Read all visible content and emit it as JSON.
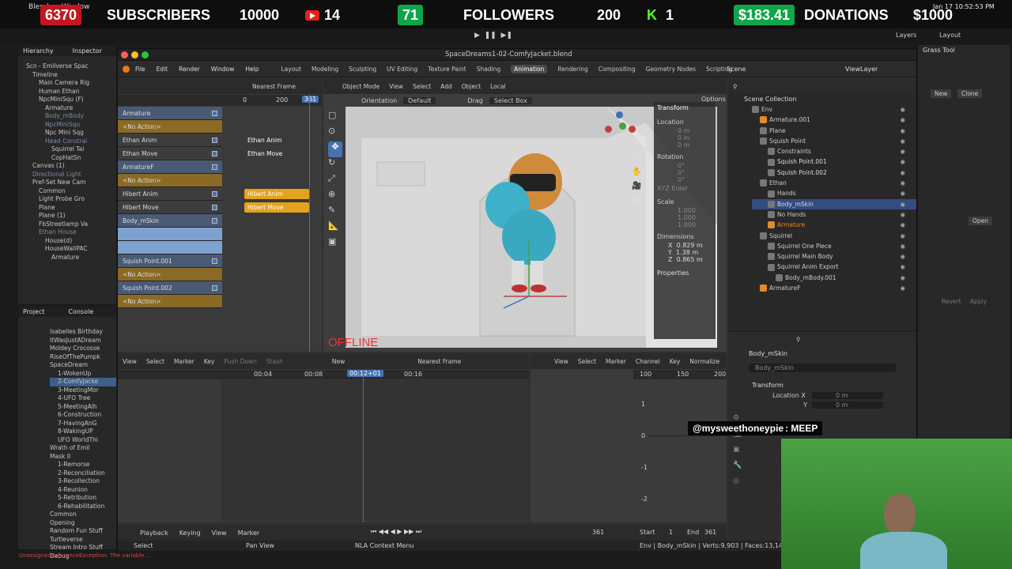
{
  "stream_bar": {
    "app_label": "Blender",
    "window_label": "Window",
    "subscriber_count": "6370",
    "subscribers_label": "SUBSCRIBERS",
    "subscriber_goal": "10000",
    "youtube_count": "14",
    "follower_count": "71",
    "followers_label": "FOLLOWERS",
    "follower_goal": "200",
    "kick_count": "1",
    "donation_amount": "$183.41",
    "donations_label": "DONATIONS",
    "donation_goal": "$1000",
    "clock": "Jan 17 10:52:53 PM"
  },
  "unity": {
    "hierarchy_tab": "Hierarchy",
    "inspector_tab": "Inspector",
    "project_tab": "Project",
    "console_tab": "Console",
    "toolbar": {
      "layers": "Layers",
      "layout": "Layout"
    },
    "hierarchy_items": [
      "Scn - Emilverse Spac",
      "Timeline",
      "Main Camera Rig",
      "Human Ethan",
      "NpcMiniSqu (F)",
      "Armature",
      "Body_mBody",
      "NpcMiniSqu",
      "Npc Mini Sqg",
      "Head Constrai",
      "Squirrel Tai",
      "CopHatSn",
      "Canvas (1)",
      "Directional Light",
      "Pref-Set New Cam",
      "Common",
      "Light Probe Gro",
      "Plane",
      "Plane (1)",
      "FbStreetlamp Va",
      "Ethan House",
      "House(d)",
      "HouseWallPAC",
      "Armature"
    ],
    "project_items": [
      "Isabelles Birthday",
      "ItWasJustADream",
      "Moldey Crocosse",
      "RiseOfThePumpk",
      "SpaceDream",
      "1-WokenUp",
      "2-ComfyJacke",
      "3-MeetingMor",
      "4-UFO Tree",
      "5-MeetingAlh",
      "6-Construction",
      "7-HavingAnG",
      "8-WakingUP",
      "UFO WorldThi",
      "Wrath of Emil",
      "Mask II",
      "1-Remorse",
      "2-Reconciliation",
      "3-Recollection",
      "4-Reunion",
      "5-Retribution",
      "6-Rehabilitation",
      "Common",
      "Opening",
      "Random Fun Stuff",
      "Turtleverse",
      "Stream Intro Stuff",
      "Debug"
    ],
    "right": {
      "grass_tool": "Grass Tool",
      "new": "New",
      "clone": "Clone",
      "open": "Open",
      "revert": "Revert",
      "apply": "Apply"
    },
    "status_error": "UnassignedReferenceException: The variable ..."
  },
  "blender": {
    "title": "SpaceDreams1-02-ComfyJacket.blend",
    "menu": [
      "File",
      "Edit",
      "Render",
      "Window",
      "Help"
    ],
    "workspaces": [
      "Layout",
      "Modeling",
      "Sculpting",
      "UV Editing",
      "Texture Paint",
      "Shading",
      "Animation",
      "Rendering",
      "Compositing",
      "Geometry Nodes",
      "Scripting"
    ],
    "active_workspace": "Animation",
    "scene": "Scene",
    "view_layer": "ViewLayer",
    "nla": {
      "snap": "Nearest Frame",
      "frame_marks": [
        "0",
        "200"
      ],
      "current_frame": "361",
      "channels": [
        {
          "label": "Armature",
          "kind": "obj"
        },
        {
          "label": "<No Action>",
          "kind": "noact"
        },
        {
          "label": "Ethan Anim",
          "kind": "track"
        },
        {
          "label": "Ethan Move",
          "kind": "track"
        },
        {
          "label": "ArmatureF",
          "kind": "obj"
        },
        {
          "label": "<No Action>",
          "kind": "noact"
        },
        {
          "label": "Hibert Anim",
          "kind": "track"
        },
        {
          "label": "Hibert Move",
          "kind": "track"
        },
        {
          "label": "Body_mSkin",
          "kind": "obj"
        },
        {
          "label": "",
          "kind": "sel"
        },
        {
          "label": "",
          "kind": "sel"
        },
        {
          "label": "Squish Point.001",
          "kind": "obj"
        },
        {
          "label": "<No Action>",
          "kind": "noact"
        },
        {
          "label": "Squish Point.002",
          "kind": "obj"
        },
        {
          "label": "<No Action>",
          "kind": "noact"
        }
      ],
      "strips": [
        "Ethan Anim",
        "Ethan Move",
        "Hibert Anim",
        "Hibert Move"
      ]
    },
    "viewport": {
      "mode": "Object Mode",
      "view": "View",
      "select": "Select",
      "add": "Add",
      "object": "Object",
      "orientation_label": "Orientation",
      "orientation": "Default",
      "drag_label": "Drag",
      "drag": "Select Box",
      "options": "Options",
      "global": "Local",
      "overlay_text": "OFFLINE"
    },
    "n_panel": {
      "title": "Transform",
      "location": "Location",
      "rotation": "Rotation",
      "mode": "XYZ Euler",
      "scale": "Scale",
      "dimensions": "Dimensions",
      "x": "0.829 m",
      "y": "1.38 m",
      "z": "0.865 m",
      "properties": "Properties",
      "loc_vals": [
        "0 m",
        "0 m",
        "0 m"
      ],
      "rot_vals": [
        "0°",
        "0°",
        "0°"
      ],
      "scale_vals": [
        "1.000",
        "1.000",
        "1.000"
      ]
    },
    "outliner": {
      "title": "Scene Collection",
      "items": [
        "Env",
        "Armature.001",
        "Plane",
        "Squish Point",
        "Constraints",
        "Squish Point.001",
        "Squish Point.002",
        "Ethan",
        "Hands",
        "Body_mSkin",
        "No Hands",
        "Armature",
        "Squirrel",
        "Squirrel One Piece",
        "Squirrel Main Body",
        "Squirrel Anim Export",
        "Body_mBody.001",
        "ArmatureF"
      ]
    },
    "properties": {
      "object_name": "Body_mSkin",
      "sub_name": "Body_mSkin",
      "transform": "Transform",
      "location": "Location X",
      "y": "Y",
      "loc_x": "0 m",
      "loc_y": "0 m"
    },
    "dopesheet": {
      "view": "View",
      "select": "Select",
      "marker": "Marker",
      "key": "Key",
      "push_down": "Push Down",
      "stash": "Stash",
      "new": "New",
      "snap": "Nearest Frame",
      "ticks": [
        "00:04",
        "00:08",
        "00:12+01",
        "00:16"
      ]
    },
    "graph": {
      "view": "View",
      "select": "Select",
      "marker": "Marker",
      "channel": "Channel",
      "key": "Key",
      "normalize": "Normalize",
      "ticks": [
        "100",
        "150",
        "200"
      ],
      "y_ticks": [
        "1",
        "0",
        "-1",
        "-2"
      ]
    },
    "timeline": {
      "playback": "Playback",
      "keying": "Keying",
      "view": "View",
      "marker": "Marker",
      "frame": "361",
      "start_label": "Start",
      "start": "1",
      "end_label": "End",
      "end": "361"
    },
    "status": {
      "select": "Select",
      "pan": "Pan View",
      "context": "NLA Context Menu",
      "stats": "Env | Body_mSkin | Verts:9,903 | Faces:13,143 | Tris"
    }
  },
  "chat": {
    "user": "@mysweethoneypie",
    "message": ": MEEP"
  }
}
